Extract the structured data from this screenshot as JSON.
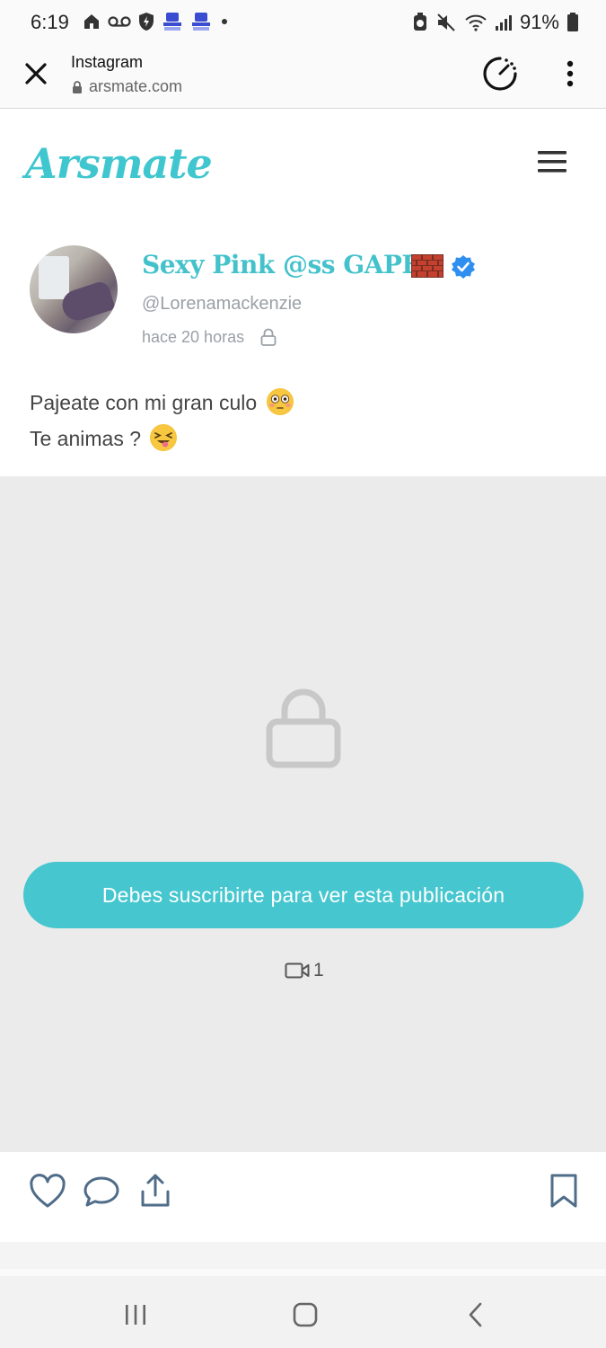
{
  "status_bar": {
    "time": "6:19",
    "battery": "91%",
    "left_icons": [
      "home-icon",
      "voicemail-icon",
      "shield-icon",
      "notification-icon",
      "notification-icon"
    ],
    "right_icons": [
      "alarm-icon",
      "mute-icon",
      "wifi-icon",
      "signal-icon",
      "battery-icon"
    ]
  },
  "browser": {
    "title": "Instagram",
    "url": "arsmate.com"
  },
  "site": {
    "logo": "Arsmate",
    "accent_color": "#46c6cf"
  },
  "post": {
    "display_name": "Sexy Pink @ss GAPE",
    "handle": "@Lorenamackenzie",
    "timestamp": "hace 20 horas",
    "caption_line1": "Pajeate con mi gran culo",
    "caption_line2": "Te animas ?",
    "subscribe_label": "Debes suscribirte para ver esta publicación",
    "media_count": "1"
  }
}
